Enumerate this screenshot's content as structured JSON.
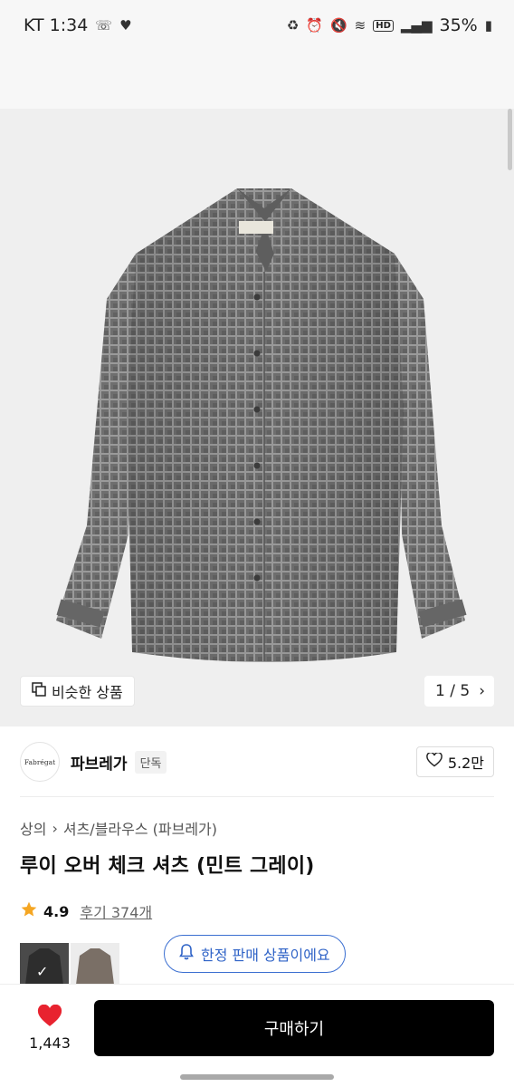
{
  "status_bar": {
    "carrier_time": "KT 1:34",
    "battery": "35%"
  },
  "hero": {
    "similar_button_label": "비슷한 상품",
    "pager": "1 / 5"
  },
  "brand": {
    "logo_text": "Fabrégat",
    "name": "파브레가",
    "badge": "단독",
    "likes": "5.2만"
  },
  "product": {
    "breadcrumb_category": "상의",
    "breadcrumb_sub": "셔츠/블라우스 (파브레가)",
    "title": "루이 오버 체크 셔츠 (민트 그레이)",
    "rating": "4.9",
    "reviews": "후기 374개",
    "limited_label": "한정 판매 상품이에요"
  },
  "bottom": {
    "heart_count": "1,443",
    "buy_label": "구매하기"
  },
  "colors": {
    "accent_blue": "#2f63c7",
    "heart_red": "#e8232f",
    "star": "#f5a623",
    "buy_bg": "#000000"
  }
}
